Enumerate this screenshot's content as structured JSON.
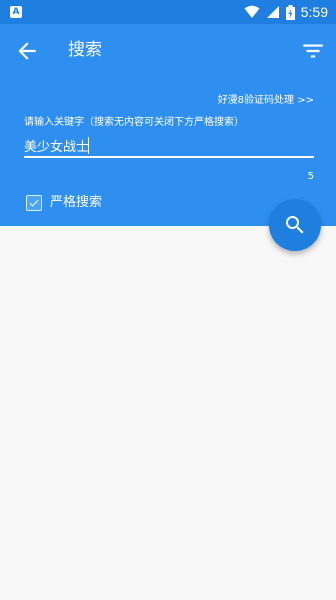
{
  "status_bar": {
    "time": "5:59",
    "notification_glyph": "A"
  },
  "header": {
    "title": "搜索",
    "verify_link": "好漫8验证码处理 >>",
    "hint": "请输入关键字（搜索无内容可关闭下方严格搜索）",
    "search_value": "美少女战士",
    "char_count": "5",
    "strict_label": "严格搜索",
    "strict_checked": true
  },
  "colors": {
    "status_bar": "#1f7fe0",
    "header": "#2f8ff0",
    "fab": "#1f7fe0",
    "background": "#f8f8f8"
  },
  "icons": {
    "back": "arrow-left-icon",
    "filter": "filter-icon",
    "search": "search-icon",
    "wifi": "wifi-icon",
    "signal": "signal-icon",
    "battery": "battery-icon"
  }
}
